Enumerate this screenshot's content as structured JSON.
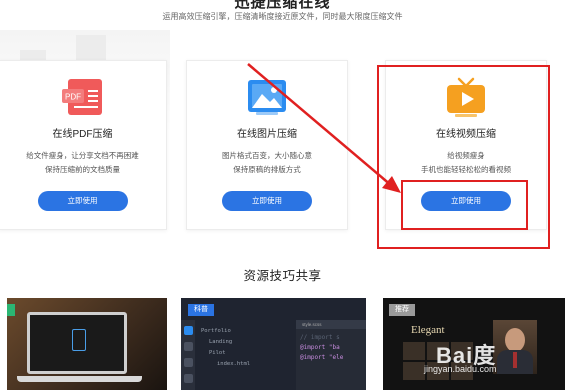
{
  "header": {
    "title_cut": "迅捷压缩在线",
    "subtitle": "运用高效压缩引擎，压缩清晰度接近原文件，同时最大限度压缩文件"
  },
  "cards": [
    {
      "title": "在线PDF压缩",
      "desc1": "给文件瘦身，让分享文档不再困难",
      "desc2": "保持压缩前的文档质量",
      "button": "立即使用",
      "icon_label": "PDF",
      "icon": "pdf-file-icon",
      "color": "#f05a5a"
    },
    {
      "title": "在线图片压缩",
      "desc1": "图片格式百变，大小随心意",
      "desc2": "保持原稿的排版方式",
      "button": "立即使用",
      "icon": "image-icon",
      "color": "#2b8cf0"
    },
    {
      "title": "在线视频压缩",
      "desc1": "给视频瘦身",
      "desc2": "手机也能轻轻松松的看视频",
      "button": "立即使用",
      "icon": "video-tv-icon",
      "color": "#f5a020"
    }
  ],
  "section": {
    "title": "资源技巧共享"
  },
  "thumbnails": [
    {
      "tag": "",
      "icon": "laptop-document-icon"
    },
    {
      "tag": "科普",
      "tree": [
        "Portfolio",
        "Landing",
        "Pilot",
        "index.html"
      ],
      "editor_tab": "style.scss",
      "code": [
        "// import s",
        "@import \"ba",
        "@import \"ele"
      ]
    },
    {
      "tag": "推荐",
      "caption": "Elegant"
    }
  ],
  "watermark": {
    "brand": "Bai度",
    "url": "jingyan.baidu.com"
  },
  "colors": {
    "accent": "#2b74e3",
    "annotation": "#e02020"
  }
}
